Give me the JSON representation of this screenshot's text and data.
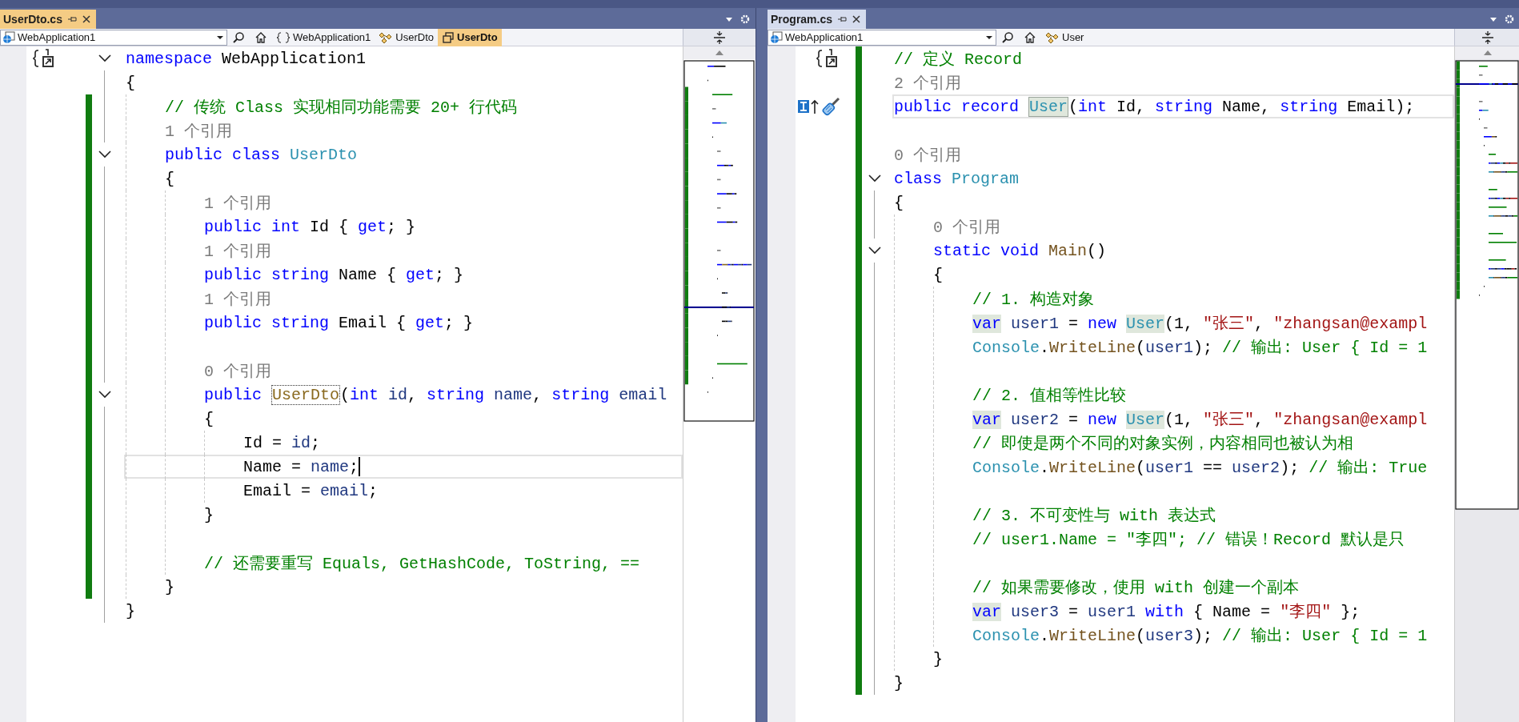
{
  "panes": [
    {
      "tab": {
        "label": "UserDto.cs",
        "selected": true
      },
      "project": "WebApplication1",
      "breadcrumbs": [
        {
          "kind": "namespace",
          "label": "WebApplication1",
          "selected": false
        },
        {
          "kind": "class",
          "label": "UserDto",
          "selected": false
        },
        {
          "kind": "member",
          "label": "UserDto",
          "selected": true
        }
      ],
      "lines": [
        {
          "kind": "namespace-link",
          "changed": false,
          "current": false,
          "expanded": true,
          "tokens": [
            {
              "kind": "kw",
              "text": "namespace"
            },
            {
              "kind": "plain",
              "text": " WebApplication1"
            }
          ]
        },
        {
          "kind": "code",
          "changed": false,
          "current": false,
          "tokens": [
            {
              "kind": "plain",
              "text": "{"
            }
          ],
          "children": [
            {
              "kind": "code",
              "changed": true,
              "current": false,
              "tokens": [
                {
                  "kind": "comment",
                  "text": "// 传统 Class 实现相同功能需要 20+ 行代码"
                }
              ]
            },
            {
              "kind": "code",
              "changed": true,
              "current": false,
              "tokens": [
                {
                  "kind": "lens",
                  "text": "1 个引用"
                }
              ]
            },
            {
              "kind": "code",
              "changed": true,
              "current": false,
              "expanded": true,
              "tokens": [
                {
                  "kind": "kw",
                  "text": "public class"
                },
                {
                  "kind": "type",
                  "text": " UserDto"
                }
              ]
            },
            {
              "kind": "code",
              "changed": true,
              "current": false,
              "tokens": [
                {
                  "kind": "plain",
                  "text": "{"
                }
              ],
              "children": [
                {
                  "kind": "code",
                  "changed": true,
                  "current": false,
                  "tokens": [
                    {
                      "kind": "lens",
                      "text": "1 个引用"
                    }
                  ]
                },
                {
                  "kind": "code",
                  "changed": true,
                  "current": false,
                  "tokens": [
                    {
                      "kind": "kw",
                      "text": "public int"
                    },
                    {
                      "kind": "prop",
                      "text": " Id "
                    },
                    {
                      "kind": "plain",
                      "text": "{ "
                    },
                    {
                      "kind": "kw",
                      "text": "get"
                    },
                    {
                      "kind": "plain",
                      "text": "; }"
                    }
                  ]
                },
                {
                  "kind": "code",
                  "changed": true,
                  "current": false,
                  "tokens": [
                    {
                      "kind": "lens",
                      "text": "1 个引用"
                    }
                  ]
                },
                {
                  "kind": "code",
                  "changed": true,
                  "current": false,
                  "tokens": [
                    {
                      "kind": "kw",
                      "text": "public string"
                    },
                    {
                      "kind": "prop",
                      "text": " Name "
                    },
                    {
                      "kind": "plain",
                      "text": "{ "
                    },
                    {
                      "kind": "kw",
                      "text": "get"
                    },
                    {
                      "kind": "plain",
                      "text": "; }"
                    }
                  ]
                },
                {
                  "kind": "code",
                  "changed": true,
                  "current": false,
                  "tokens": [
                    {
                      "kind": "lens",
                      "text": "1 个引用"
                    }
                  ]
                },
                {
                  "kind": "code",
                  "changed": true,
                  "current": false,
                  "tokens": [
                    {
                      "kind": "kw",
                      "text": "public string"
                    },
                    {
                      "kind": "prop",
                      "text": " Email "
                    },
                    {
                      "kind": "plain",
                      "text": "{ "
                    },
                    {
                      "kind": "kw",
                      "text": "get"
                    },
                    {
                      "kind": "plain",
                      "text": "; }"
                    }
                  ]
                },
                {
                  "kind": "code",
                  "changed": true,
                  "current": false
                },
                {
                  "kind": "code",
                  "changed": true,
                  "current": false,
                  "tokens": [
                    {
                      "kind": "lens",
                      "text": "0 个引用"
                    }
                  ]
                },
                {
                  "kind": "code",
                  "changed": true,
                  "current": false,
                  "expanded": true,
                  "tokens": [
                    {
                      "kind": "kw",
                      "text": "public "
                    },
                    {
                      "kind": "type-rename",
                      "text": "UserDto"
                    },
                    {
                      "kind": "plain",
                      "text": "("
                    },
                    {
                      "kind": "kw",
                      "text": "int"
                    },
                    {
                      "kind": "var",
                      "text": " id"
                    },
                    {
                      "kind": "plain",
                      "text": ", "
                    },
                    {
                      "kind": "kw",
                      "text": "string"
                    },
                    {
                      "kind": "var",
                      "text": " name"
                    },
                    {
                      "kind": "plain",
                      "text": ", "
                    },
                    {
                      "kind": "kw",
                      "text": "string"
                    },
                    {
                      "kind": "var",
                      "text": " email"
                    }
                  ]
                },
                {
                  "kind": "code",
                  "changed": true,
                  "current": false,
                  "tokens": [
                    {
                      "kind": "plain",
                      "text": "{"
                    }
                  ],
                  "children": [
                    {
                      "kind": "code",
                      "changed": true,
                      "current": false,
                      "tokens": [
                        {
                          "kind": "prop",
                          "text": "Id"
                        },
                        {
                          "kind": "plain",
                          "text": " = "
                        },
                        {
                          "kind": "var",
                          "text": "id"
                        },
                        {
                          "kind": "plain",
                          "text": ";"
                        }
                      ]
                    },
                    {
                      "kind": "code",
                      "changed": true,
                      "current": true,
                      "tokens": [
                        {
                          "kind": "prop",
                          "text": "Name"
                        },
                        {
                          "kind": "plain",
                          "text": " = "
                        },
                        {
                          "kind": "var",
                          "text": "name"
                        },
                        {
                          "kind": "plain",
                          "text": ";"
                        }
                      ]
                    },
                    {
                      "kind": "code",
                      "changed": true,
                      "current": false,
                      "tokens": [
                        {
                          "kind": "prop",
                          "text": "Email"
                        },
                        {
                          "kind": "plain",
                          "text": " = "
                        },
                        {
                          "kind": "var",
                          "text": "email"
                        },
                        {
                          "kind": "plain",
                          "text": ";"
                        }
                      ]
                    }
                  ]
                },
                {
                  "kind": "code",
                  "changed": true,
                  "current": false,
                  "tokens": [
                    {
                      "kind": "plain",
                      "text": "}"
                    }
                  ]
                },
                {
                  "kind": "code",
                  "changed": true,
                  "current": false
                },
                {
                  "kind": "code",
                  "changed": true,
                  "current": false,
                  "tokens": [
                    {
                      "kind": "comment",
                      "text": "// 还需要重写 Equals, GetHashCode, ToString, =="
                    }
                  ]
                }
              ]
            },
            {
              "kind": "code",
              "changed": true,
              "current": false,
              "tokens": [
                {
                  "kind": "plain",
                  "text": "}"
                }
              ]
            }
          ]
        },
        {
          "kind": "code",
          "changed": false,
          "current": false,
          "tokens": [
            {
              "kind": "plain",
              "text": "}"
            }
          ]
        }
      ]
    },
    {
      "tab": {
        "label": "Program.cs",
        "selected": false
      },
      "project": "WebApplication1",
      "breadcrumbs": [
        {
          "kind": "class",
          "label": "User",
          "selected": false
        }
      ],
      "lines": [
        {
          "kind": "namespace-link",
          "changed": true,
          "current": false,
          "tokens": [
            {
              "kind": "comment",
              "text": "// 定义 Record"
            }
          ]
        },
        {
          "kind": "code",
          "changed": true,
          "current": false,
          "tokens": [
            {
              "kind": "lens",
              "text": "2 个引用"
            }
          ]
        },
        {
          "kind": "quick-actions",
          "changed": true,
          "current": true,
          "tokens": [
            {
              "kind": "kw",
              "text": "public record "
            },
            {
              "kind": "type-def",
              "text": "User"
            },
            {
              "kind": "plain",
              "text": "("
            },
            {
              "kind": "kw",
              "text": "int"
            },
            {
              "kind": "plain",
              "text": " Id, "
            },
            {
              "kind": "kw",
              "text": "string"
            },
            {
              "kind": "plain",
              "text": " Name, "
            },
            {
              "kind": "kw",
              "text": "string"
            },
            {
              "kind": "plain",
              "text": " Email);"
            }
          ]
        },
        {
          "kind": "code",
          "changed": true,
          "current": false
        },
        {
          "kind": "code",
          "changed": true,
          "current": false,
          "tokens": [
            {
              "kind": "lens",
              "text": "0 个引用"
            }
          ]
        },
        {
          "kind": "code",
          "changed": true,
          "current": false,
          "expanded": true,
          "tokens": [
            {
              "kind": "kw",
              "text": "class"
            },
            {
              "kind": "type",
              "text": " Program"
            }
          ]
        },
        {
          "kind": "code",
          "changed": true,
          "current": false,
          "tokens": [
            {
              "kind": "plain",
              "text": "{"
            }
          ],
          "children": [
            {
              "kind": "code",
              "changed": true,
              "current": false,
              "tokens": [
                {
                  "kind": "lens",
                  "text": "0 个引用"
                }
              ]
            },
            {
              "kind": "code",
              "changed": true,
              "current": false,
              "expanded": true,
              "tokens": [
                {
                  "kind": "kw",
                  "text": "static void"
                },
                {
                  "kind": "method",
                  "text": " Main"
                },
                {
                  "kind": "plain",
                  "text": "()"
                }
              ]
            },
            {
              "kind": "code",
              "changed": true,
              "current": false,
              "tokens": [
                {
                  "kind": "plain",
                  "text": "{"
                }
              ],
              "children": [
                {
                  "kind": "code",
                  "changed": true,
                  "current": false,
                  "tokens": [
                    {
                      "kind": "comment",
                      "text": "// 1. 构造对象"
                    }
                  ]
                },
                {
                  "kind": "code",
                  "changed": true,
                  "current": false,
                  "tokens": [
                    {
                      "kind": "kw-ref",
                      "text": "var"
                    },
                    {
                      "kind": "var",
                      "text": " user1"
                    },
                    {
                      "kind": "plain",
                      "text": " = "
                    },
                    {
                      "kind": "kw",
                      "text": "new "
                    },
                    {
                      "kind": "type-ref",
                      "text": "User"
                    },
                    {
                      "kind": "plain",
                      "text": "(1, "
                    },
                    {
                      "kind": "string",
                      "text": "\"张三\""
                    },
                    {
                      "kind": "plain",
                      "text": ", "
                    },
                    {
                      "kind": "string",
                      "text": "\"zhangsan@exampl"
                    }
                  ]
                },
                {
                  "kind": "code",
                  "changed": true,
                  "current": false,
                  "tokens": [
                    {
                      "kind": "type",
                      "text": "Console"
                    },
                    {
                      "kind": "plain",
                      "text": "."
                    },
                    {
                      "kind": "method",
                      "text": "WriteLine"
                    },
                    {
                      "kind": "plain",
                      "text": "("
                    },
                    {
                      "kind": "var",
                      "text": "user1"
                    },
                    {
                      "kind": "plain",
                      "text": "); "
                    },
                    {
                      "kind": "comment",
                      "text": "// 输出: User { Id = 1"
                    }
                  ]
                },
                {
                  "kind": "code",
                  "changed": true,
                  "current": false
                },
                {
                  "kind": "code",
                  "changed": true,
                  "current": false,
                  "tokens": [
                    {
                      "kind": "comment",
                      "text": "// 2. 值相等性比较"
                    }
                  ]
                },
                {
                  "kind": "code",
                  "changed": true,
                  "current": false,
                  "tokens": [
                    {
                      "kind": "kw-ref",
                      "text": "var"
                    },
                    {
                      "kind": "var",
                      "text": " user2"
                    },
                    {
                      "kind": "plain",
                      "text": " = "
                    },
                    {
                      "kind": "kw",
                      "text": "new "
                    },
                    {
                      "kind": "type-ref",
                      "text": "User"
                    },
                    {
                      "kind": "plain",
                      "text": "(1, "
                    },
                    {
                      "kind": "string",
                      "text": "\"张三\""
                    },
                    {
                      "kind": "plain",
                      "text": ", "
                    },
                    {
                      "kind": "string",
                      "text": "\"zhangsan@exampl"
                    }
                  ]
                },
                {
                  "kind": "code",
                  "changed": true,
                  "current": false,
                  "tokens": [
                    {
                      "kind": "comment",
                      "text": "// 即使是两个不同的对象实例，内容相同也被认为相"
                    }
                  ]
                },
                {
                  "kind": "code",
                  "changed": true,
                  "current": false,
                  "tokens": [
                    {
                      "kind": "type",
                      "text": "Console"
                    },
                    {
                      "kind": "plain",
                      "text": "."
                    },
                    {
                      "kind": "method",
                      "text": "WriteLine"
                    },
                    {
                      "kind": "plain",
                      "text": "("
                    },
                    {
                      "kind": "var",
                      "text": "user1"
                    },
                    {
                      "kind": "plain",
                      "text": " == "
                    },
                    {
                      "kind": "var",
                      "text": "user2"
                    },
                    {
                      "kind": "plain",
                      "text": "); "
                    },
                    {
                      "kind": "comment",
                      "text": "// 输出: True"
                    }
                  ]
                },
                {
                  "kind": "code",
                  "changed": true,
                  "current": false
                },
                {
                  "kind": "code",
                  "changed": true,
                  "current": false,
                  "tokens": [
                    {
                      "kind": "comment",
                      "text": "// 3. 不可变性与 with 表达式"
                    }
                  ]
                },
                {
                  "kind": "code",
                  "changed": true,
                  "current": false,
                  "tokens": [
                    {
                      "kind": "comment",
                      "text": "// user1.Name = \"李四\"; // 错误！Record 默认是只"
                    }
                  ]
                },
                {
                  "kind": "code",
                  "changed": true,
                  "current": false
                },
                {
                  "kind": "code",
                  "changed": true,
                  "current": false,
                  "tokens": [
                    {
                      "kind": "comment",
                      "text": "// 如果需要修改，使用 with 创建一个副本"
                    }
                  ]
                },
                {
                  "kind": "code",
                  "changed": true,
                  "current": false,
                  "tokens": [
                    {
                      "kind": "kw-ref",
                      "text": "var"
                    },
                    {
                      "kind": "var",
                      "text": " user3"
                    },
                    {
                      "kind": "plain",
                      "text": " = "
                    },
                    {
                      "kind": "var",
                      "text": "user1"
                    },
                    {
                      "kind": "kw",
                      "text": " with"
                    },
                    {
                      "kind": "plain",
                      "text": " { "
                    },
                    {
                      "kind": "prop",
                      "text": "Name"
                    },
                    {
                      "kind": "plain",
                      "text": " = "
                    },
                    {
                      "kind": "string",
                      "text": "\"李四\""
                    },
                    {
                      "kind": "plain",
                      "text": " };"
                    }
                  ]
                },
                {
                  "kind": "code",
                  "changed": true,
                  "current": false,
                  "tokens": [
                    {
                      "kind": "type",
                      "text": "Console"
                    },
                    {
                      "kind": "plain",
                      "text": "."
                    },
                    {
                      "kind": "method",
                      "text": "WriteLine"
                    },
                    {
                      "kind": "plain",
                      "text": "("
                    },
                    {
                      "kind": "var",
                      "text": "user3"
                    },
                    {
                      "kind": "plain",
                      "text": "); "
                    },
                    {
                      "kind": "comment",
                      "text": "// 输出: User { Id = 1"
                    }
                  ]
                }
              ]
            },
            {
              "kind": "code",
              "changed": true,
              "current": false,
              "tokens": [
                {
                  "kind": "plain",
                  "text": "}"
                }
              ]
            }
          ]
        },
        {
          "kind": "code",
          "changed": true,
          "current": false,
          "tokens": [
            {
              "kind": "plain",
              "text": "}"
            }
          ]
        }
      ]
    }
  ]
}
